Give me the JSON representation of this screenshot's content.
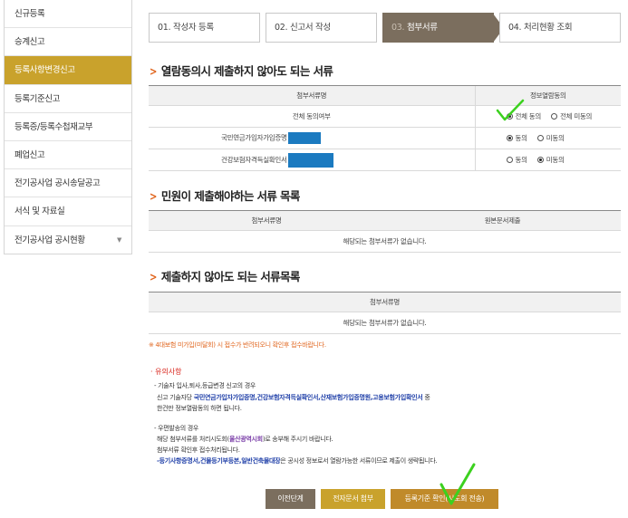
{
  "sidebar": {
    "items": [
      {
        "label": "신규등록"
      },
      {
        "label": "승계신고"
      },
      {
        "label": "등록사항변경신고"
      },
      {
        "label": "등록기준신고"
      },
      {
        "label": "등록증/등록수첩재교부"
      },
      {
        "label": "폐업신고"
      },
      {
        "label": "전기공사업 공시송달공고"
      },
      {
        "label": "서식 및 자료실"
      },
      {
        "label": "전기공사업 공시현황"
      }
    ],
    "active_index": 2
  },
  "steps": [
    {
      "num": "01.",
      "label": "작성자 등록"
    },
    {
      "num": "02.",
      "label": "신고서 작성"
    },
    {
      "num": "03.",
      "label": "첨부서류"
    },
    {
      "num": "04.",
      "label": "처리현황 조회"
    }
  ],
  "section1": {
    "title": "열람동의시 제출하지 않아도 되는 서류",
    "headers": [
      "첨부서류명",
      "정보열람동의"
    ],
    "rows": [
      {
        "name": "전체 동의여부",
        "opt1": "전체 동의",
        "opt2": "전체 미동의",
        "selected": 1
      },
      {
        "name": "국민연금가입자가입증명",
        "opt1": "동의",
        "opt2": "미동의",
        "selected": 1
      },
      {
        "name": "건강보험자격득실확인서",
        "opt1": "동의",
        "opt2": "미동의",
        "selected": 2
      }
    ]
  },
  "section2": {
    "title": "민원이 제출해야하는 서류 목록",
    "headers": [
      "첨부서류명",
      "원본문서제출"
    ],
    "empty": "해당되는 첨부서류가 없습니다."
  },
  "section3": {
    "title": "제출하지 않아도 되는 서류목록",
    "headers": [
      "첨부서류명"
    ],
    "empty": "해당되는 첨부서류가 없습니다."
  },
  "warning": "※ 4대보험 미가입(미달회) 시 접수가 반려되오니 확인후 접수바랍니다.",
  "notice": {
    "title": "· 유의사항",
    "line1": "- 기술자 입사,퇴사,등급변경 신고의 경우",
    "line2_pre": "신고 기술자당 ",
    "line2_hl": "국민연금가입자가입증명,건강보험자격득실확인서,산재보험가입증명원,고용보험가입확인서",
    "line2_post": " 중",
    "line3": "한건만 정보열람동의 하면 됩니다.",
    "line4": "- 우편발송의 경우",
    "line5_pre": "해당 첨부서류를 처리시도회(",
    "line5_hl": "울산광역시회",
    "line5_post": ")로 송부해 주시기 바랍니다.",
    "line6": "첨부서류 확인후 접수처리됩니다.",
    "line7_hl": "-등기사항증명서,건물등기부등본,일반건축물대장",
    "line7_post": "은 공시성 정보로서 열람가능한 서류이므로 제출이 생략됩니다."
  },
  "buttons": {
    "prev": "이전단계",
    "esubmit": "전자문서 첨부",
    "register": "등록기준 확인(시도회 전송)"
  },
  "colors": {
    "accent": "#c9a22c",
    "step_active": "#7b6e5e",
    "chevron": "#e0641c",
    "annotation_check": "#3cd11f",
    "redacted_block": "#1b7ac0"
  }
}
